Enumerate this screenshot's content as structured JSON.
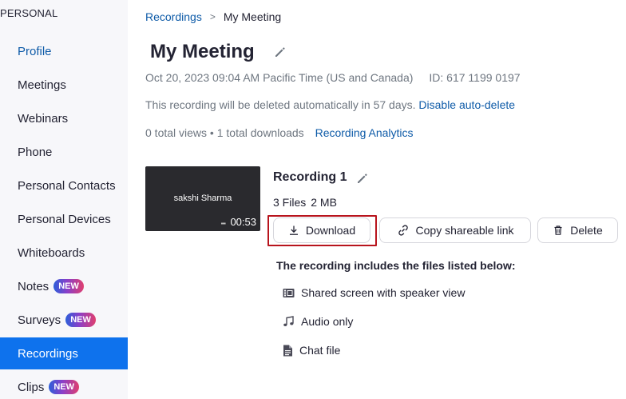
{
  "sidebar": {
    "header": "PERSONAL",
    "items": [
      {
        "label": "Profile"
      },
      {
        "label": "Meetings"
      },
      {
        "label": "Webinars"
      },
      {
        "label": "Phone"
      },
      {
        "label": "Personal Contacts"
      },
      {
        "label": "Personal Devices"
      },
      {
        "label": "Whiteboards"
      },
      {
        "label": "Notes",
        "badge": "NEW"
      },
      {
        "label": "Surveys",
        "badge": "NEW"
      },
      {
        "label": "Recordings",
        "active": true
      },
      {
        "label": "Clips",
        "badge": "NEW"
      }
    ]
  },
  "breadcrumb": {
    "parent": "Recordings",
    "separator": ">",
    "current": "My Meeting"
  },
  "meeting": {
    "title": "My Meeting",
    "datetime": "Oct 20, 2023 09:04 AM Pacific Time (US and Canada)",
    "id": "ID: 617 1199 0197",
    "auto_delete_text": "This recording will be deleted automatically in 57 days.",
    "disable_auto_delete": "Disable auto-delete",
    "stats": "0 total views • 1 total downloads",
    "analytics_link": "Recording Analytics"
  },
  "recording": {
    "thumbnail_name": "sakshi Sharma",
    "duration": "00:53",
    "title": "Recording 1",
    "files": "3 Files",
    "size": "2 MB",
    "download_label": "Download",
    "copy_link_label": "Copy shareable link",
    "delete_label": "Delete",
    "includes_heading": "The recording includes the files listed below:",
    "file_list": [
      {
        "label": "Shared screen with speaker view",
        "icon": "video-film-icon"
      },
      {
        "label": "Audio only",
        "icon": "music-note-icon"
      },
      {
        "label": "Chat file",
        "icon": "document-icon"
      }
    ]
  },
  "colors": {
    "accent": "#0e72ed",
    "link": "#0e5ba8",
    "highlight_border": "#b8141d",
    "sidebar_bg": "#f7f7fa"
  }
}
